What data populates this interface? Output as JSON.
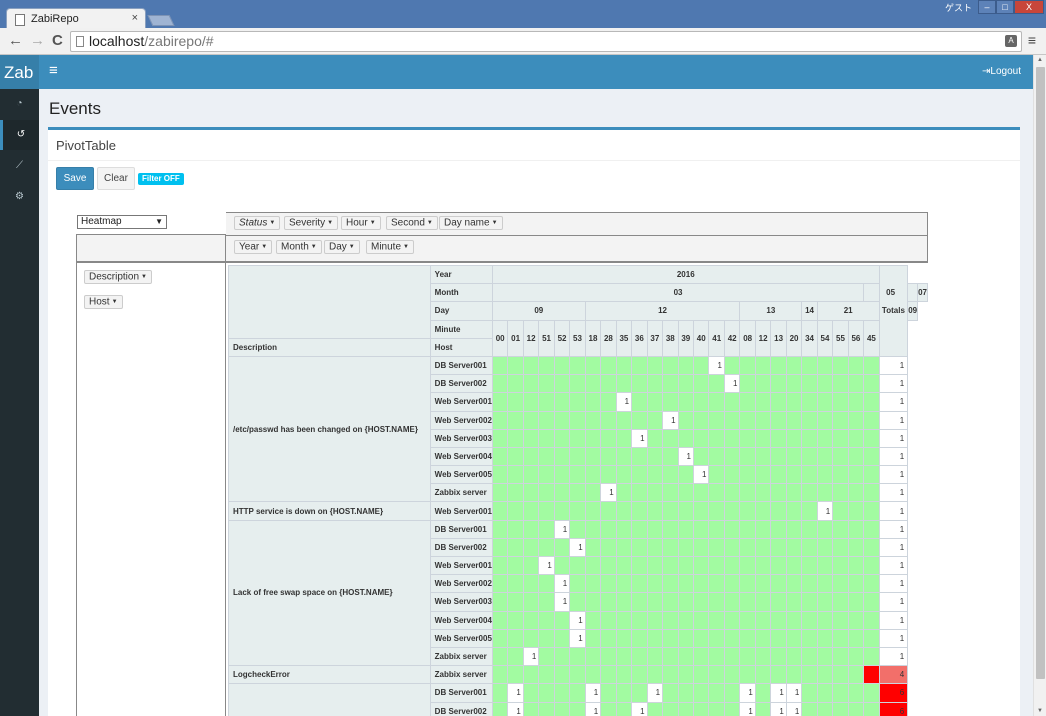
{
  "browser": {
    "tab_title": "ZabiRepo",
    "tab_close": "×",
    "url_host": "localhost",
    "url_path": "/zabirepo/#",
    "window_user": "ゲスト",
    "win_min": "–",
    "win_max": "□",
    "win_close": "X",
    "back": "←",
    "forward": "→",
    "reload": "C",
    "menu": "≡"
  },
  "header": {
    "brand": "Zab",
    "menu_toggle": "≡",
    "logout": "Logout"
  },
  "sidebar": [
    "dashboard-icon",
    "history-icon",
    "chart-icon",
    "settings-icon"
  ],
  "page": {
    "title": "Events"
  },
  "box": {
    "title": "PivotTable",
    "save": "Save",
    "clear": "Clear",
    "filter_badge": "Filter OFF"
  },
  "pivot": {
    "renderer": "Heatmap",
    "unused_attrs": [
      "Status",
      "Severity",
      "Hour",
      "Second",
      "Day name"
    ],
    "col_attrs": [
      "Year",
      "Month",
      "Day",
      "Minute"
    ],
    "row_attrs": [
      "Description",
      "Host"
    ],
    "labels": {
      "year": "Year",
      "month": "Month",
      "day": "Day",
      "minute": "Minute",
      "description": "Description",
      "host": "Host",
      "totals": "Totals"
    },
    "year": "2016",
    "months": [
      {
        "label": "03",
        "span": 24
      },
      {
        "label": "05",
        "span": 4
      },
      {
        "label": "07",
        "span": 1
      }
    ],
    "days": [
      {
        "label": "09",
        "span": 6
      },
      {
        "label": "12",
        "span": 10
      },
      {
        "label": "13",
        "span": 4
      },
      {
        "label": "14",
        "span": 1
      },
      {
        "label": "21",
        "span": 4
      },
      {
        "label": "09",
        "span": 1
      }
    ],
    "minutes": [
      "00",
      "01",
      "12",
      "51",
      "52",
      "53",
      "18",
      "28",
      "35",
      "36",
      "37",
      "38",
      "39",
      "40",
      "41",
      "42",
      "08",
      "12",
      "13",
      "20",
      "34",
      "54",
      "55",
      "56",
      "45"
    ],
    "rows": [
      {
        "desc": "/etc/passwd has been changed on {HOST.NAME}",
        "host": "DB Server001",
        "values": {
          "14": 1
        },
        "total": "1"
      },
      {
        "desc": "",
        "host": "DB Server002",
        "values": {
          "15": 1
        },
        "total": "1"
      },
      {
        "desc": "",
        "host": "Web Server001",
        "values": {
          "8": 1
        },
        "total": "1"
      },
      {
        "desc": "",
        "host": "Web Server002",
        "values": {
          "11": 1
        },
        "total": "1"
      },
      {
        "desc": "",
        "host": "Web Server003",
        "values": {
          "9": 1
        },
        "total": "1"
      },
      {
        "desc": "",
        "host": "Web Server004",
        "values": {
          "12": 1
        },
        "total": "1"
      },
      {
        "desc": "",
        "host": "Web Server005",
        "values": {
          "13": 1
        },
        "total": "1"
      },
      {
        "desc": "",
        "host": "Zabbix server",
        "values": {
          "7": 1
        },
        "total": "1"
      },
      {
        "desc": "HTTP service is down on {HOST.NAME}",
        "host": "Web Server001",
        "values": {
          "21": 1
        },
        "total": "1"
      },
      {
        "desc": "Lack of free swap space on {HOST.NAME}",
        "host": "DB Server001",
        "values": {
          "4": 1
        },
        "total": "1"
      },
      {
        "desc": "",
        "host": "DB Server002",
        "values": {
          "5": 1
        },
        "total": "1"
      },
      {
        "desc": "",
        "host": "Web Server001",
        "values": {
          "3": 1
        },
        "total": "1"
      },
      {
        "desc": "",
        "host": "Web Server002",
        "values": {
          "4": 1
        },
        "total": "1"
      },
      {
        "desc": "",
        "host": "Web Server003",
        "values": {
          "4": 1
        },
        "total": "1"
      },
      {
        "desc": "",
        "host": "Web Server004",
        "values": {
          "5": 1
        },
        "total": "1"
      },
      {
        "desc": "",
        "host": "Web Server005",
        "values": {
          "5": 1
        },
        "total": "1"
      },
      {
        "desc": "",
        "host": "Zabbix server",
        "values": {
          "2": 1
        },
        "total": "1"
      },
      {
        "desc": "LogcheckError",
        "host": "Zabbix server",
        "values": {},
        "hot": [
          24
        ],
        "total": "4",
        "total_class": "warm"
      },
      {
        "desc": "",
        "host": "DB Server001",
        "values": {
          "1": 1,
          "6": 1,
          "10": 1,
          "16": 1,
          "18": 1,
          "19": 1
        },
        "total": "6",
        "total_class": "hot"
      },
      {
        "desc": "",
        "host": "DB Server002",
        "values": {
          "1": 1,
          "6": 1,
          "9": 1,
          "16": 1,
          "18": 1,
          "19": 1
        },
        "total": "6",
        "total_class": "hot"
      }
    ],
    "row_groups": [
      {
        "start": 0,
        "span": 8
      },
      {
        "start": 8,
        "span": 1
      },
      {
        "start": 9,
        "span": 8
      },
      {
        "start": 17,
        "span": 1
      },
      {
        "start": 18,
        "span": 2
      }
    ]
  }
}
